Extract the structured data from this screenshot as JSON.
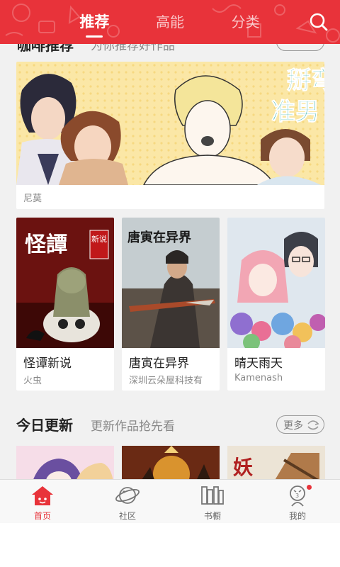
{
  "header": {
    "tabs": [
      {
        "label": "推荐",
        "active": true
      },
      {
        "label": "高能",
        "active": false
      },
      {
        "label": "分类",
        "active": false
      }
    ],
    "search_icon": "search-icon",
    "accent_color": "#e8333a"
  },
  "featured": {
    "section_title": "咖啡推荐",
    "section_subtitle": "为你推荐好作品",
    "banner_text_1": "掰弯",
    "banner_text_2": "准男",
    "banner_author": "尼莫"
  },
  "comics": [
    {
      "title": "怪谭新说",
      "author": "火虫",
      "cover_text": "怪譚",
      "cover_seal": "新说"
    },
    {
      "title": "唐寅在异界",
      "author": "深圳云朵屋科技有",
      "cover_text": "唐寅在异界"
    },
    {
      "title": "晴天雨天",
      "author": "Kamenash"
    }
  ],
  "today": {
    "title": "今日更新",
    "subtitle": "更新作品抢先看",
    "more_label": "更多"
  },
  "bottom_nav": [
    {
      "label": "首页",
      "icon": "home-icon",
      "active": true
    },
    {
      "label": "社区",
      "icon": "planet-icon",
      "active": false
    },
    {
      "label": "书橱",
      "icon": "bookshelf-icon",
      "active": false
    },
    {
      "label": "我的",
      "icon": "profile-icon",
      "active": false,
      "badge": true
    }
  ]
}
